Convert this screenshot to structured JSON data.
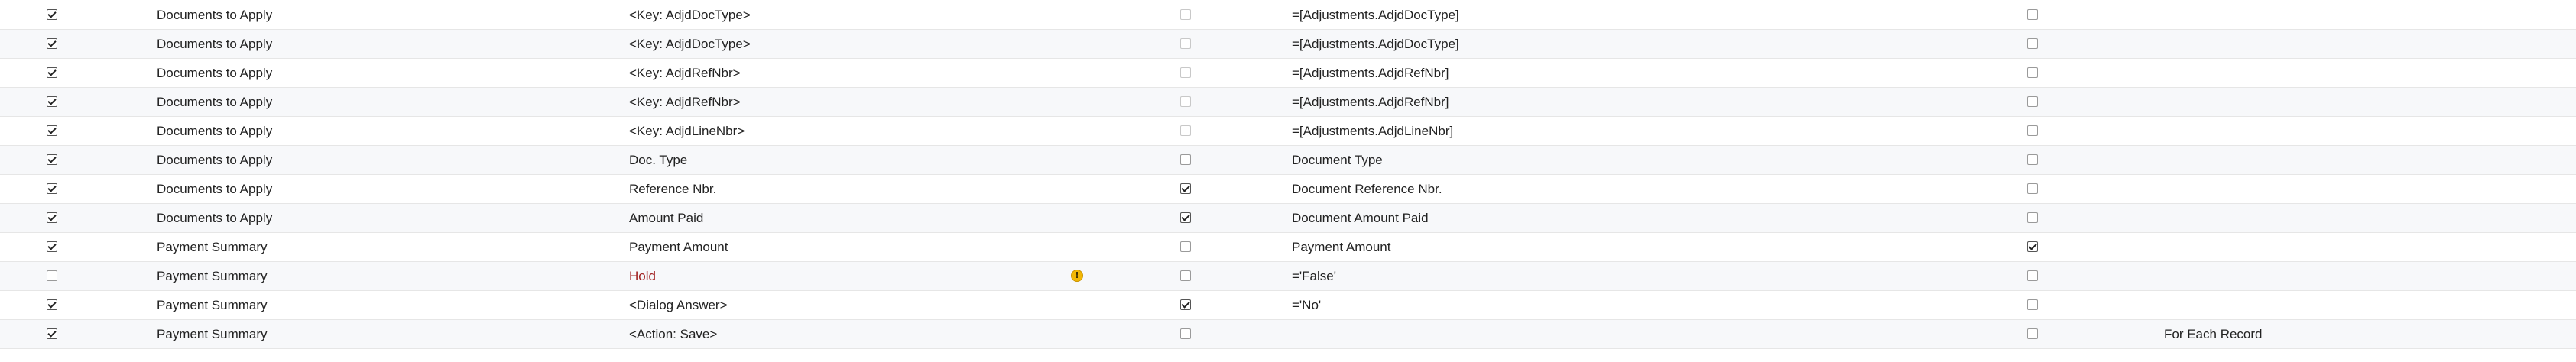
{
  "rows": [
    {
      "active": true,
      "object": "Documents to Apply",
      "field": "<Key: AdjdDocType>",
      "warn": false,
      "commit": false,
      "commit_dim": true,
      "value": "=[Adjustments.AdjdDocType]",
      "ignore": false,
      "mode": ""
    },
    {
      "active": true,
      "object": "Documents to Apply",
      "field": "<Key: AdjdDocType>",
      "warn": false,
      "commit": false,
      "commit_dim": true,
      "value": "=[Adjustments.AdjdDocType]",
      "ignore": false,
      "mode": ""
    },
    {
      "active": true,
      "object": "Documents to Apply",
      "field": "<Key: AdjdRefNbr>",
      "warn": false,
      "commit": false,
      "commit_dim": true,
      "value": "=[Adjustments.AdjdRefNbr]",
      "ignore": false,
      "mode": ""
    },
    {
      "active": true,
      "object": "Documents to Apply",
      "field": "<Key: AdjdRefNbr>",
      "warn": false,
      "commit": false,
      "commit_dim": true,
      "value": "=[Adjustments.AdjdRefNbr]",
      "ignore": false,
      "mode": ""
    },
    {
      "active": true,
      "object": "Documents to Apply",
      "field": "<Key: AdjdLineNbr>",
      "warn": false,
      "commit": false,
      "commit_dim": true,
      "value": "=[Adjustments.AdjdLineNbr]",
      "ignore": false,
      "mode": ""
    },
    {
      "active": true,
      "object": "Documents to Apply",
      "field": "Doc. Type",
      "warn": false,
      "commit": false,
      "commit_dim": false,
      "value": "Document Type",
      "ignore": false,
      "mode": ""
    },
    {
      "active": true,
      "object": "Documents to Apply",
      "field": "Reference Nbr.",
      "warn": false,
      "commit": true,
      "commit_dim": false,
      "value": "Document Reference Nbr.",
      "ignore": false,
      "mode": ""
    },
    {
      "active": true,
      "object": "Documents to Apply",
      "field": "Amount Paid",
      "warn": false,
      "commit": true,
      "commit_dim": false,
      "value": "Document Amount Paid",
      "ignore": false,
      "mode": ""
    },
    {
      "active": true,
      "object": "Payment Summary",
      "field": "Payment Amount",
      "warn": false,
      "commit": false,
      "commit_dim": false,
      "value": "Payment Amount",
      "ignore": true,
      "mode": ""
    },
    {
      "active": false,
      "object": "Payment Summary",
      "field": "Hold",
      "warn": true,
      "commit": false,
      "commit_dim": false,
      "value": "='False'",
      "ignore": false,
      "mode": "",
      "field_red": true
    },
    {
      "active": true,
      "object": "Payment Summary",
      "field": "<Dialog Answer>",
      "warn": false,
      "commit": true,
      "commit_dim": false,
      "value": "='No'",
      "ignore": false,
      "mode": ""
    },
    {
      "active": true,
      "object": "Payment Summary",
      "field": "<Action: Save>",
      "warn": false,
      "commit": false,
      "commit_dim": false,
      "value": "",
      "ignore": false,
      "mode": "For Each Record"
    }
  ],
  "warn_icon": {
    "name": "warning-icon",
    "glyph": "!",
    "color": "#f2b705"
  },
  "colors": {
    "error_text": "#a02020",
    "row_alt": "#f7f8fa"
  }
}
